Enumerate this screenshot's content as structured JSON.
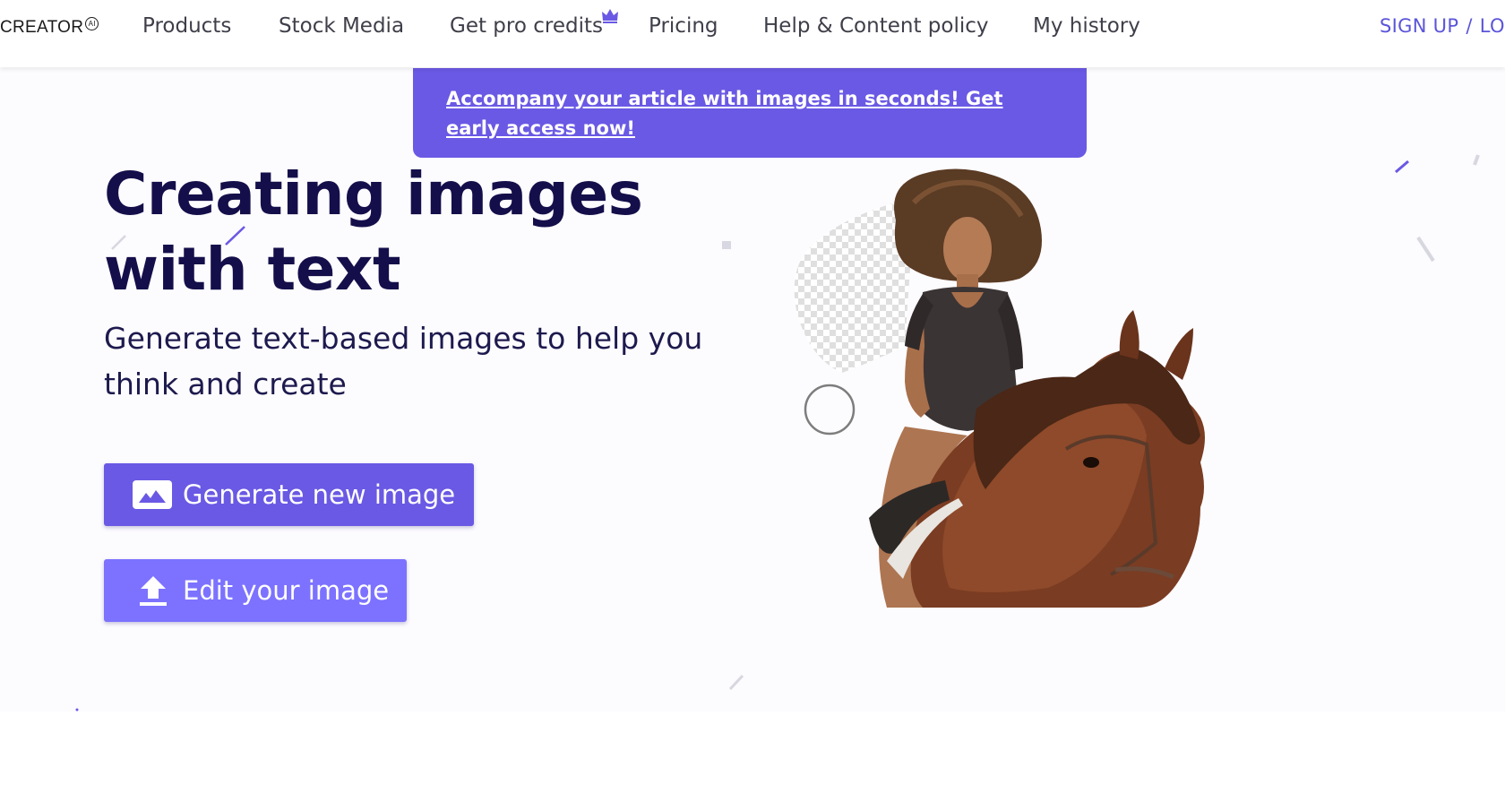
{
  "header": {
    "logo_text": "CREATOR",
    "logo_badge": "AI",
    "nav": [
      {
        "label": "Products"
      },
      {
        "label": "Stock Media"
      },
      {
        "label": "Get pro credits"
      },
      {
        "label": "Pricing"
      },
      {
        "label": "Help & Content policy"
      },
      {
        "label": "My history"
      }
    ],
    "auth": {
      "signup": "SIGN UP",
      "separator": "/",
      "login": "LOG"
    }
  },
  "banner": {
    "text": "Accompany your article with images in seconds! Get early access now!"
  },
  "hero": {
    "title": "Creating images with text",
    "subtitle": "Generate text-based images to help you think and create",
    "buttons": {
      "generate_label": "Generate new image",
      "edit_label": "Edit your image"
    }
  },
  "icons": {
    "generate": "image-icon",
    "edit": "upload-icon",
    "pro_credits": "crown-icon"
  },
  "colors": {
    "primary": "#6a59e4",
    "secondary_button": "#7c72ff",
    "heading": "#140f4a",
    "nav_text": "#3f3f4a",
    "auth_link": "#5b55d9",
    "hero_background": "#fcfbfe"
  }
}
